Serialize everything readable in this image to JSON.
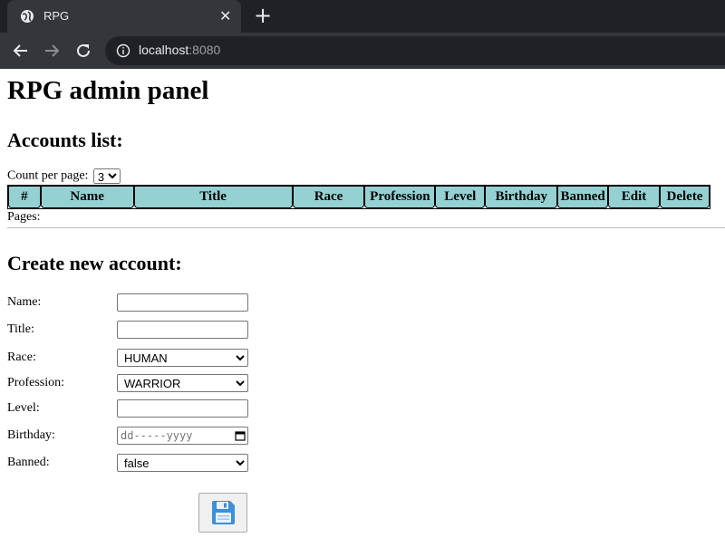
{
  "browser": {
    "tab_title": "RPG",
    "url_host": "localhost",
    "url_port": ":8080"
  },
  "page": {
    "title": "RPG admin panel",
    "accounts_heading": "Accounts list:",
    "count_label": "Count per page:",
    "count_value": "3",
    "columns": [
      "#",
      "Name",
      "Title",
      "Race",
      "Profession",
      "Level",
      "Birthday",
      "Banned",
      "Edit",
      "Delete"
    ],
    "pages_label": "Pages:",
    "create_heading": "Create new account:"
  },
  "form": {
    "name_label": "Name:",
    "title_label": "Title:",
    "race_label": "Race:",
    "race_value": "HUMAN",
    "profession_label": "Profession:",
    "profession_value": "WARRIOR",
    "level_label": "Level:",
    "birthday_label": "Birthday:",
    "birthday_placeholder": "dd-----yyyy",
    "banned_label": "Banned:",
    "banned_value": "false"
  },
  "icons": {
    "favicon": "globe-icon",
    "save": "floppy-disk-icon"
  },
  "colors": {
    "header_cell": "#95d1d3",
    "chrome_dark": "#202124",
    "chrome_tab": "#35363a",
    "save_icon_blue": "#3d8fd8"
  }
}
